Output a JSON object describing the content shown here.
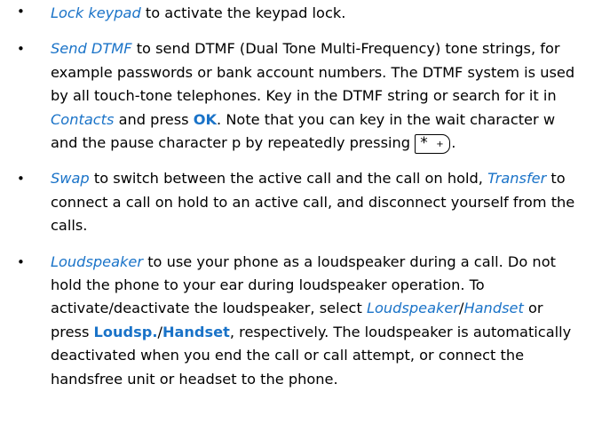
{
  "bullet": "•",
  "colors": {
    "link": "#1a73c8",
    "text": "#000000"
  },
  "items": [
    {
      "segments": [
        {
          "style": "italic-link",
          "text": "Lock keypad"
        },
        {
          "style": "plain",
          "text": " to activate the keypad lock."
        }
      ]
    },
    {
      "segments": [
        {
          "style": "italic-link",
          "text": "Send DTMF"
        },
        {
          "style": "plain",
          "text": " to send DTMF (Dual Tone Multi-Frequency) tone strings, for example passwords or bank account numbers. The DTMF system is used by all touch-tone telephones. Key in the DTMF string or search for it in "
        },
        {
          "style": "italic-link",
          "text": "Contacts"
        },
        {
          "style": "plain",
          "text": " and press "
        },
        {
          "style": "bold-key",
          "text": "OK"
        },
        {
          "style": "plain",
          "text": ". Note that you can key in the wait character w and the pause character p by repeatedly pressing "
        },
        {
          "style": "keycap",
          "text": "* +"
        },
        {
          "style": "plain",
          "text": "."
        }
      ]
    },
    {
      "segments": [
        {
          "style": "italic-link",
          "text": "Swap"
        },
        {
          "style": "plain",
          "text": " to switch between the active call and the call on hold, "
        },
        {
          "style": "italic-link",
          "text": "Transfer"
        },
        {
          "style": "plain",
          "text": " to connect a call on hold to an active call, and disconnect yourself from the calls."
        }
      ]
    },
    {
      "segments": [
        {
          "style": "italic-link",
          "text": "Loudspeaker"
        },
        {
          "style": "plain",
          "text": " to use your phone as a loudspeaker during a call. Do not hold the phone to your ear during loudspeaker operation. To activate/deactivate the loudspeaker, select "
        },
        {
          "style": "italic-link",
          "text": "Loudspeaker"
        },
        {
          "style": "plain",
          "text": "/"
        },
        {
          "style": "italic-link",
          "text": "Handset"
        },
        {
          "style": "plain",
          "text": " or press "
        },
        {
          "style": "bold-key",
          "text": "Loudsp."
        },
        {
          "style": "plain",
          "text": "/"
        },
        {
          "style": "bold-key",
          "text": "Handset"
        },
        {
          "style": "plain",
          "text": ", respectively. The loudspeaker is automatically deactivated when you end the call or call attempt, or connect the handsfree unit or headset to the phone."
        }
      ]
    }
  ]
}
